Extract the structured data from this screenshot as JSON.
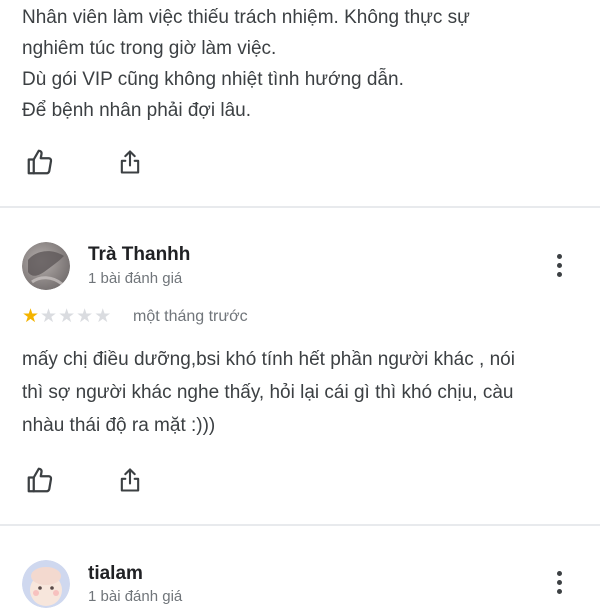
{
  "review_top": {
    "lines": [
      "Nhân viên làm việc thiếu trách nhiệm. Không thực sự",
      "nghiêm túc trong giờ làm việc.",
      "Dù gói VIP cũng không nhiệt tình hướng dẫn.",
      "Để bệnh nhân phải đợi lâu."
    ]
  },
  "review_tra": {
    "author": "Trà Thanhh",
    "review_count": "1 bài đánh giá",
    "rating": 1,
    "rating_max": 5,
    "time_ago": "một tháng trước",
    "lines": [
      "mấy chị điều dưỡng,bsi khó tính hết phần người khác , nói",
      "thì sợ người khác nghe thấy, hỏi lại cái gì thì khó chịu, càu",
      "nhàu thái độ ra mặt :)))"
    ]
  },
  "review_tialam": {
    "author": "tialam",
    "review_count": "1 bài đánh giá"
  },
  "icons": {
    "like": "thumbs-up-icon",
    "share": "share-icon",
    "more": "more-vert-icon"
  },
  "colors": {
    "star_filled": "#f4b400",
    "star_empty": "#dadce0",
    "divider": "#e8eaed",
    "secondary_text": "#70757a"
  }
}
